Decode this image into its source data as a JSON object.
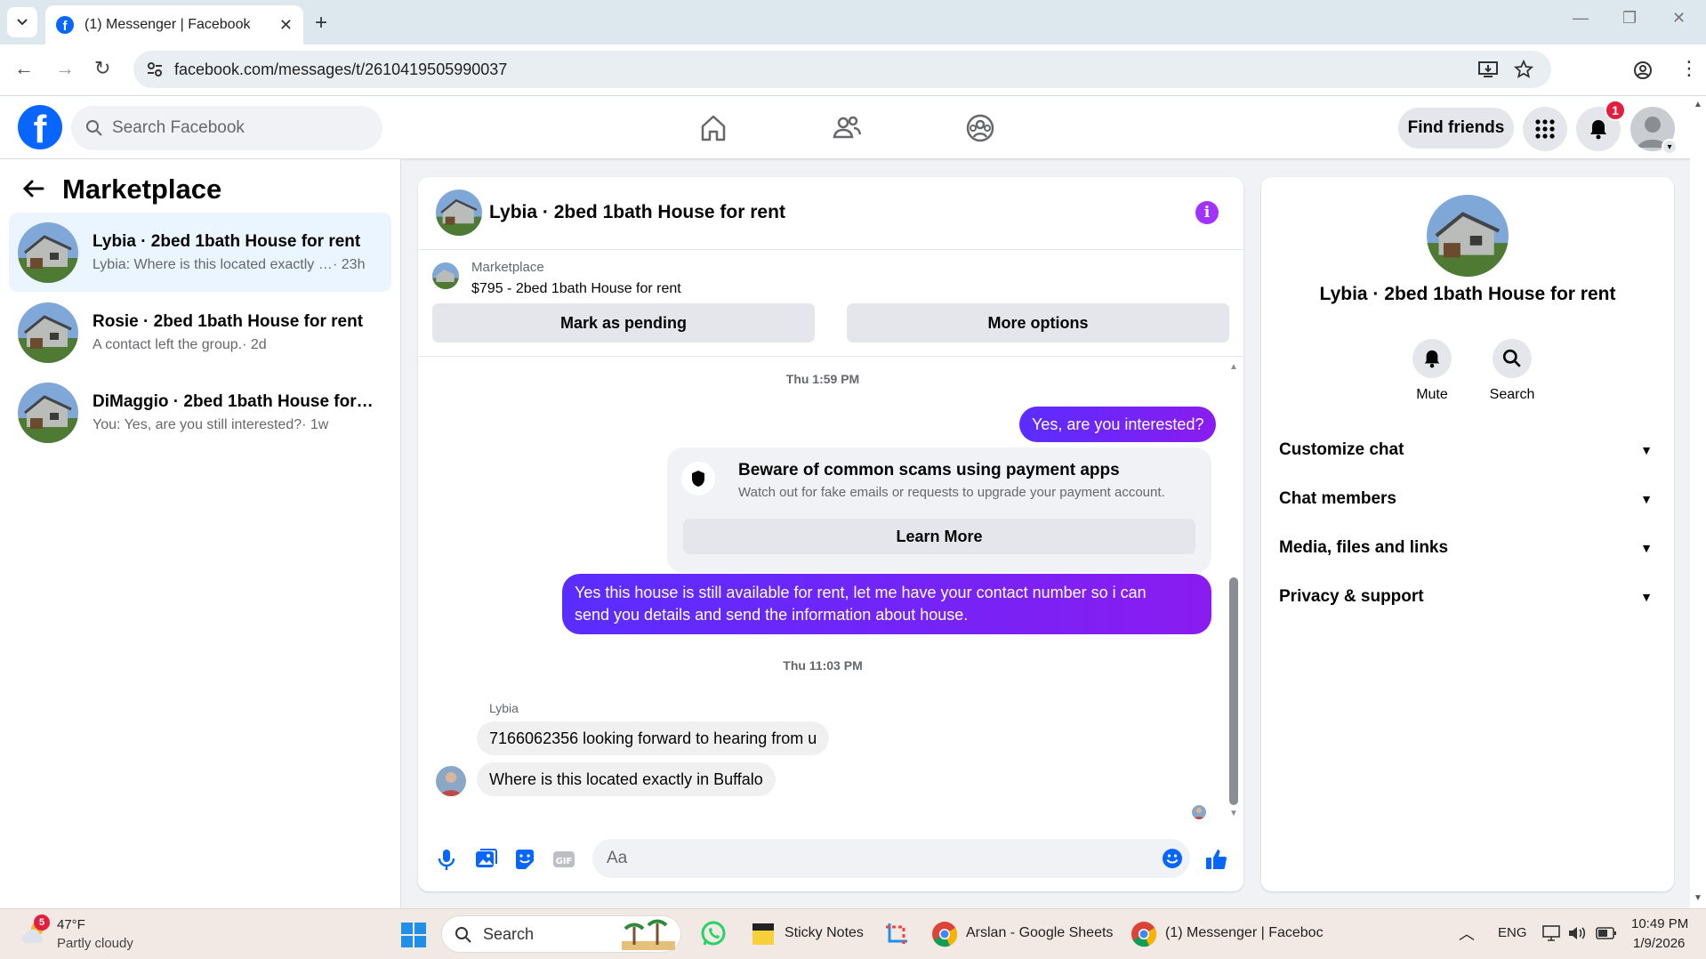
{
  "browser": {
    "tab_title": "(1) Messenger | Facebook",
    "url": "facebook.com/messages/t/2610419505990037"
  },
  "header": {
    "search_placeholder": "Search Facebook",
    "find_friends": "Find friends",
    "notification_count": "1"
  },
  "sidebar": {
    "title": "Marketplace",
    "conversations": [
      {
        "title": "Lybia · 2bed 1bath House for rent",
        "preview": "Lybia: Where is this located exactly i...",
        "time": " · 23h",
        "active": true
      },
      {
        "title": "Rosie · 2bed 1bath House for rent",
        "preview": "A contact left the group.",
        "time": " · 2d",
        "active": false
      },
      {
        "title": "DiMaggio · 2bed 1bath House for r...",
        "preview": "You: Yes, are you still interested?",
        "time": " · 1w",
        "active": false
      }
    ]
  },
  "chat": {
    "title": "Lybia · 2bed 1bath House for rent",
    "listing_source": "Marketplace",
    "listing_title": "$795 - 2bed 1bath House for rent",
    "mark_pending": "Mark as pending",
    "more_options": "More options",
    "timestamp1": "Thu 1:59 PM",
    "msg_out1": "Yes, are you interested?",
    "scam_title": "Beware of common scams using payment apps",
    "scam_sub": "Watch out for fake emails or requests to upgrade your payment account.",
    "learn_more": "Learn More",
    "msg_out2_line1": "Yes this house is still available for rent, let me have your contact number so i can",
    "msg_out2_line2": "send you details and send the information about house.",
    "timestamp2": "Thu 11:03 PM",
    "sender_name": "Lybia",
    "msg_in1": "7166062356 looking forward to hearing from u",
    "msg_in2": "Where is this located exactly in Buffalo",
    "composer_placeholder": "Aa"
  },
  "details": {
    "title": "Lybia · 2bed 1bath House for rent",
    "mute": "Mute",
    "search": "Search",
    "sections": [
      "Customize chat",
      "Chat members",
      "Media, files and links",
      "Privacy & support"
    ]
  },
  "taskbar": {
    "weather_badge": "5",
    "temperature": "47°F",
    "weather": "Partly cloudy",
    "search": "Search",
    "sticky_notes": "Sticky Notes",
    "sheets": "Arslan - Google Sheets",
    "messenger": "(1) Messenger | Faceboc",
    "lang": "ENG",
    "time": "10:49 PM",
    "date": "1/9/2026"
  },
  "colors": {
    "brand_blue": "#0866ff",
    "outgoing_bubble": "#6a2af6",
    "info_purple": "#a033ff"
  }
}
